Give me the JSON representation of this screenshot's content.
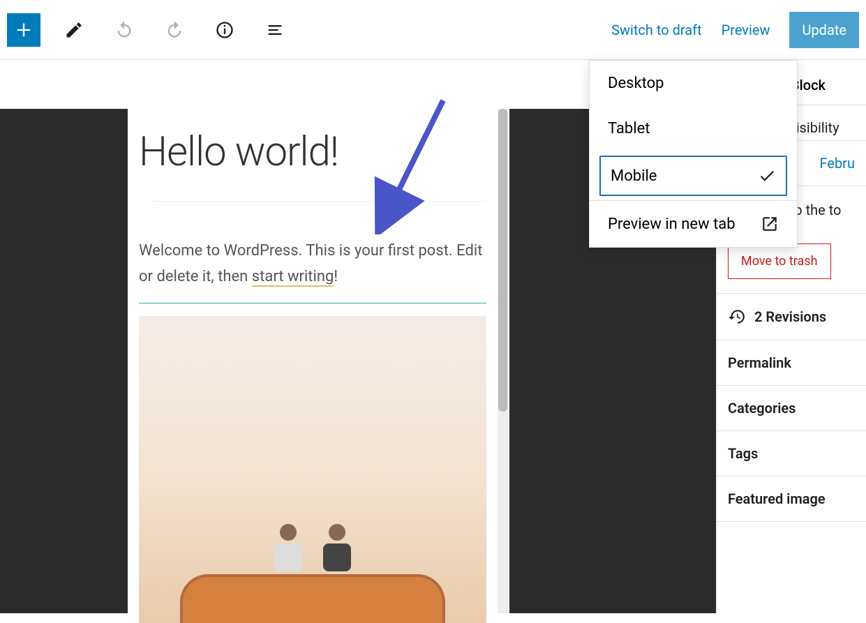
{
  "toolbar": {
    "switch_draft": "Switch to draft",
    "preview": "Preview",
    "update": "Update"
  },
  "preview_menu": {
    "desktop": "Desktop",
    "tablet": "Tablet",
    "mobile": "Mobile",
    "new_tab": "Preview in new tab"
  },
  "post": {
    "title": "Hello world!",
    "body_pre": "Welcome to WordPress. This is your first post. Edit or delete it, then ",
    "body_link": "start writing",
    "body_post": "!"
  },
  "sidebar": {
    "block_tab": "Block",
    "visibility_partial": "visibility",
    "date_partial": "Febru",
    "sticky": "Stick to the to",
    "trash": "Move to trash",
    "revisions": "2 Revisions",
    "permalink": "Permalink",
    "categories": "Categories",
    "tags": "Tags",
    "featured": "Featured image"
  }
}
